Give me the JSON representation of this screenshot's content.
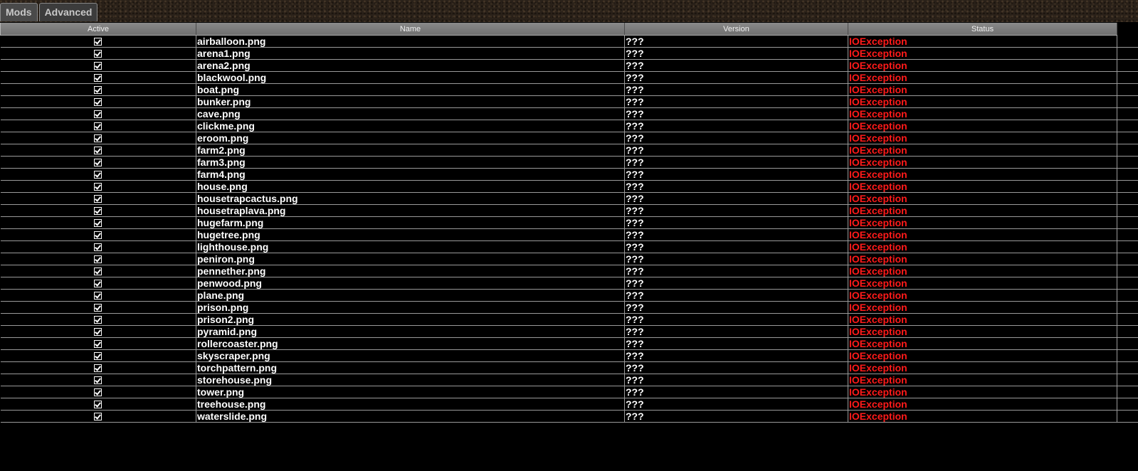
{
  "tabs": [
    {
      "label": "Mods"
    },
    {
      "label": "Advanced"
    }
  ],
  "table": {
    "columns": [
      "Active",
      "Name",
      "Version",
      "Status"
    ],
    "rows": [
      {
        "active": true,
        "name": "airballoon.png",
        "version": "???",
        "status": "IOException"
      },
      {
        "active": true,
        "name": "arena1.png",
        "version": "???",
        "status": "IOException"
      },
      {
        "active": true,
        "name": "arena2.png",
        "version": "???",
        "status": "IOException"
      },
      {
        "active": true,
        "name": "blackwool.png",
        "version": "???",
        "status": "IOException"
      },
      {
        "active": true,
        "name": "boat.png",
        "version": "???",
        "status": "IOException"
      },
      {
        "active": true,
        "name": "bunker.png",
        "version": "???",
        "status": "IOException"
      },
      {
        "active": true,
        "name": "cave.png",
        "version": "???",
        "status": "IOException"
      },
      {
        "active": true,
        "name": "clickme.png",
        "version": "???",
        "status": "IOException"
      },
      {
        "active": true,
        "name": "eroom.png",
        "version": "???",
        "status": "IOException"
      },
      {
        "active": true,
        "name": "farm2.png",
        "version": "???",
        "status": "IOException"
      },
      {
        "active": true,
        "name": "farm3.png",
        "version": "???",
        "status": "IOException"
      },
      {
        "active": true,
        "name": "farm4.png",
        "version": "???",
        "status": "IOException"
      },
      {
        "active": true,
        "name": "house.png",
        "version": "???",
        "status": "IOException"
      },
      {
        "active": true,
        "name": "housetrapcactus.png",
        "version": "???",
        "status": "IOException"
      },
      {
        "active": true,
        "name": "housetraplava.png",
        "version": "???",
        "status": "IOException"
      },
      {
        "active": true,
        "name": "hugefarm.png",
        "version": "???",
        "status": "IOException"
      },
      {
        "active": true,
        "name": "hugetree.png",
        "version": "???",
        "status": "IOException"
      },
      {
        "active": true,
        "name": "lighthouse.png",
        "version": "???",
        "status": "IOException"
      },
      {
        "active": true,
        "name": "peniron.png",
        "version": "???",
        "status": "IOException"
      },
      {
        "active": true,
        "name": "pennether.png",
        "version": "???",
        "status": "IOException"
      },
      {
        "active": true,
        "name": "penwood.png",
        "version": "???",
        "status": "IOException"
      },
      {
        "active": true,
        "name": "plane.png",
        "version": "???",
        "status": "IOException"
      },
      {
        "active": true,
        "name": "prison.png",
        "version": "???",
        "status": "IOException"
      },
      {
        "active": true,
        "name": "prison2.png",
        "version": "???",
        "status": "IOException"
      },
      {
        "active": true,
        "name": "pyramid.png",
        "version": "???",
        "status": "IOException"
      },
      {
        "active": true,
        "name": "rollercoaster.png",
        "version": "???",
        "status": "IOException"
      },
      {
        "active": true,
        "name": "skyscraper.png",
        "version": "???",
        "status": "IOException"
      },
      {
        "active": true,
        "name": "torchpattern.png",
        "version": "???",
        "status": "IOException"
      },
      {
        "active": true,
        "name": "storehouse.png",
        "version": "???",
        "status": "IOException"
      },
      {
        "active": true,
        "name": "tower.png",
        "version": "???",
        "status": "IOException"
      },
      {
        "active": true,
        "name": "treehouse.png",
        "version": "???",
        "status": "IOException"
      },
      {
        "active": true,
        "name": "waterslide.png",
        "version": "???",
        "status": "IOException"
      }
    ]
  },
  "colors": {
    "status_error": "#ff1a1a",
    "background": "#000000",
    "header": "#7a7a7a"
  },
  "icons": {
    "active_checkbox": "checkbox-checked-icon"
  }
}
